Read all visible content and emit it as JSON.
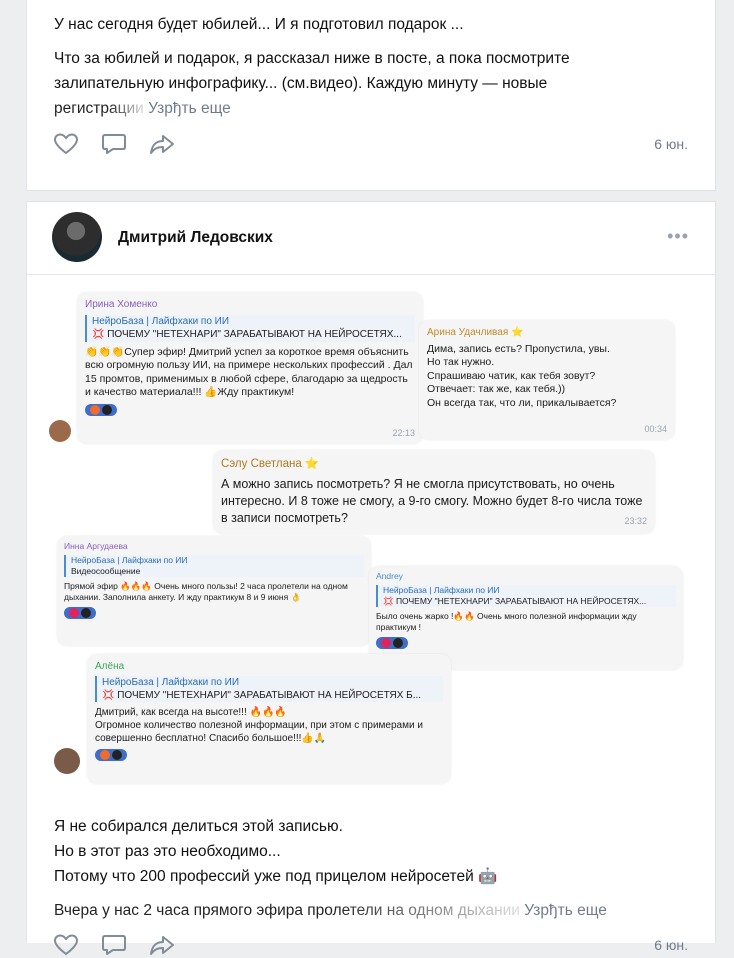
{
  "post1": {
    "line1": "У нас сегодня будет юбилей... И я подготовил подарок ...",
    "line2": "Что за юбилей и подарок, я рассказал ниже в посте, а пока посмотрите",
    "line3": "залипательную инфографику... (см.видео). Каждую минуту — новые",
    "line4": "регистрации",
    "more": "Узрђть еще",
    "date": "6 юн."
  },
  "post2": {
    "author": "Дмитрий Ледовских",
    "menu": "•••",
    "text": {
      "l1": "Я не собирался делиться этой записью.",
      "l2": "Но в этот раз это необходимо...",
      "l3": "Потому что 200 профессий уже под прицелом нейросетей 🤖",
      "l4": "Вчера у нас 2 часа прямого эфира пролетели на одном дыхании",
      "more": "Узрђть еще"
    },
    "date": "6 юн."
  },
  "collage": {
    "m1": {
      "name": "Ирина Хоменко",
      "quote_title": "НейроБаза | Лайфхаки по ИИ",
      "quote_sub": "💢 ПОЧЕМУ \"НЕТЕХНАРИ\" ЗАРАБАТЫВАЮТ НА НЕЙРОСЕТЯХ...",
      "text": "👏👏👏Супер эфир! Дмитрий успел за короткое время объяснить всю огромную пользу ИИ, на примере нескольких профессий . Дал 15 промтов, применимых в любой сфере, благодарю за щедрость и качество материала!!! 👍Жду практикум!",
      "time": "22:13"
    },
    "m2": {
      "name": "Арина Удачливая ⭐",
      "text1": "Дима, запись есть? Пропустила, увы.",
      "text2": "Но так нужно.",
      "text3": "Спрашиваю чатик, как тебя зовут?",
      "text4": "Отвечает: так же, как тебя.))",
      "text5": "Он всегда так, что ли, прикалывается?",
      "time": "00:34"
    },
    "m3": {
      "name": "Сэлу Светлана ⭐",
      "text": "А можно запись посмотреть? Я не смогла присутствовать, но очень интересно. И 8 тоже не смогу, а 9-го смогу. Можно будет 8-го числа тоже в записи посмотреть?",
      "time": "23:32"
    },
    "m4": {
      "name": "Инна Аргудаева",
      "quote_title": "НейроБаза | Лайфхаки по ИИ",
      "quote_sub": "Видеосообщение",
      "text": "Прямой эфир 🔥🔥🔥 Очень много пользы! 2 часа пролетели на одном дыхании. Заполнила анкету. И жду практикум 8 и 9 июня 👌"
    },
    "m5": {
      "name": "Andrey",
      "quote_title": "НейроБаза | Лайфхаки по ИИ",
      "quote_sub": "💢 ПОЧЕМУ \"НЕТЕХНАРИ\" ЗАРАБАТЫВАЮТ НА НЕЙРОСЕТЯХ...",
      "text": "Было очень жарко !🔥🔥 Очень много полезной информации жду практикум !"
    },
    "m6": {
      "name": "Алёна",
      "quote_title": "НейроБаза | Лайфхаки по ИИ",
      "quote_sub": "💢 ПОЧЕМУ \"НЕТЕХНАРИ\" ЗАРАБАТЫВАЮТ НА НЕЙРОСЕТЯХ Б...",
      "text1": "Дмитрий, как всегда на высоте!!! 🔥🔥🔥",
      "text2": "Огромное количество полезной информации, при этом с примерами и совершенно бесплатно! Спасибо большое!!!👍🙏"
    }
  },
  "icons": {
    "like": "heart-icon",
    "comment": "comment-icon",
    "share": "share-icon"
  },
  "colors": {
    "link": "#6e7c8c",
    "accent": "#3f6ec9",
    "background": "#edeef0"
  }
}
